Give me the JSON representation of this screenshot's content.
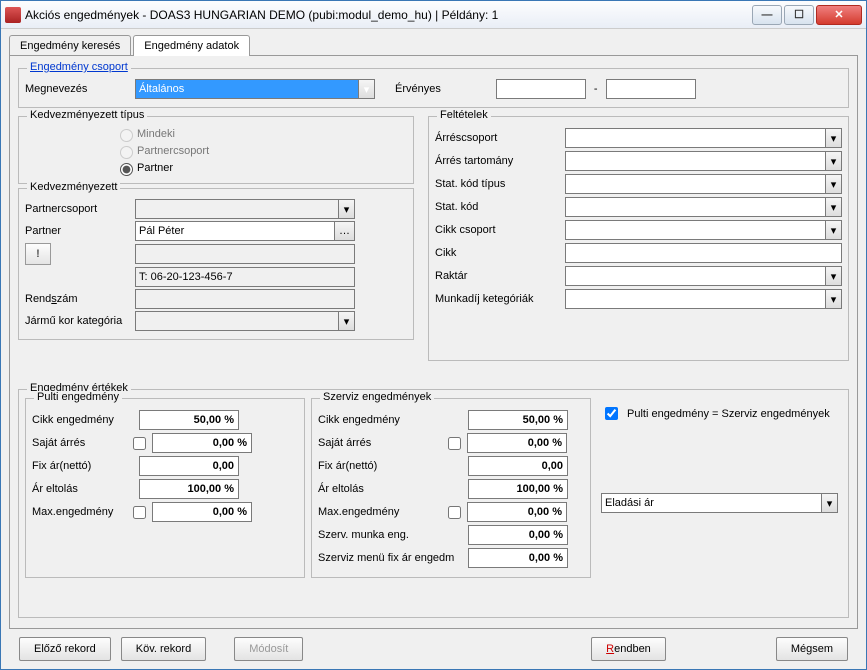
{
  "title": "Akciós engedmények - DOAS3 HUNGARIAN DEMO (pubi:modul_demo_hu) | Példány: 1",
  "tabs": {
    "search": "Engedmény keresés",
    "data": "Engedmény adatok"
  },
  "group_csoport": "Engedmény csoport",
  "megnevezes_label": "Megnevezés",
  "megnevezes_value": "Általános",
  "ervenyes_label": "Érvényes",
  "ervenyes_from": "",
  "ervenyes_to": "",
  "kedv_tipus_legend": "Kedvezményezett típus",
  "radio_mindenki": "Mindeki",
  "radio_partnercsoport": "Partnercsoport",
  "radio_partner": "Partner",
  "kedv_legend": "Kedvezményezett",
  "partnercsoport_lbl": "Partnercsoport",
  "partner_lbl": "Partner",
  "partner_value": "Pál Péter",
  "partner_phone": "T: 06-20-123-456-7",
  "rendszam_lbl": "Rendszám",
  "jarmu_lbl": "Jármű kor kategória",
  "felt_legend": "Feltételek",
  "cond": {
    "arrescsoport": "Árréscsoport",
    "arres_tartomany": "Árrés tartomány",
    "stat_kod_tipus": "Stat. kód típus",
    "stat_kod": "Stat. kód",
    "cikk_csoport": "Cikk csoport",
    "cikk": "Cikk",
    "raktar": "Raktár",
    "munkadij": "Munkadíj ketegóriák"
  },
  "eng_ertekek_legend": "Engedmény értékek",
  "pulti_legend": "Pulti engedmény",
  "szerviz_legend": "Szerviz engedmények",
  "labels": {
    "cikk_eng": "Cikk engedmény",
    "sajat_arres": "Saját árrés",
    "fix_ar": "Fix ár(nettó)",
    "ar_eltolas": "Ár eltolás",
    "max_eng": "Max.engedmény",
    "szerv_munka": "Szerv. munka eng.",
    "szerviz_menu": "Szerviz menü fix ár engedm"
  },
  "values": {
    "pulti_cikk": "50,00 %",
    "pulti_sajat": "0,00 %",
    "pulti_fix": "0,00",
    "pulti_eltolas": "100,00 %",
    "pulti_max": "0,00 %",
    "sz_cikk": "50,00 %",
    "sz_sajat": "0,00 %",
    "sz_fix": "0,00",
    "sz_eltolas": "100,00 %",
    "sz_max": "0,00 %",
    "sz_munka": "0,00 %",
    "sz_menu": "0,00 %"
  },
  "equal_chk": "Pulti engedmény = Szerviz engedmények",
  "eladasi_ar": "Eladási ár",
  "buttons": {
    "prev": "Előző rekord",
    "next": "Köv. rekord",
    "modify": "Módosít",
    "ok_pre": "R",
    "ok_rest": "endben",
    "cancel": "Mégsem"
  }
}
